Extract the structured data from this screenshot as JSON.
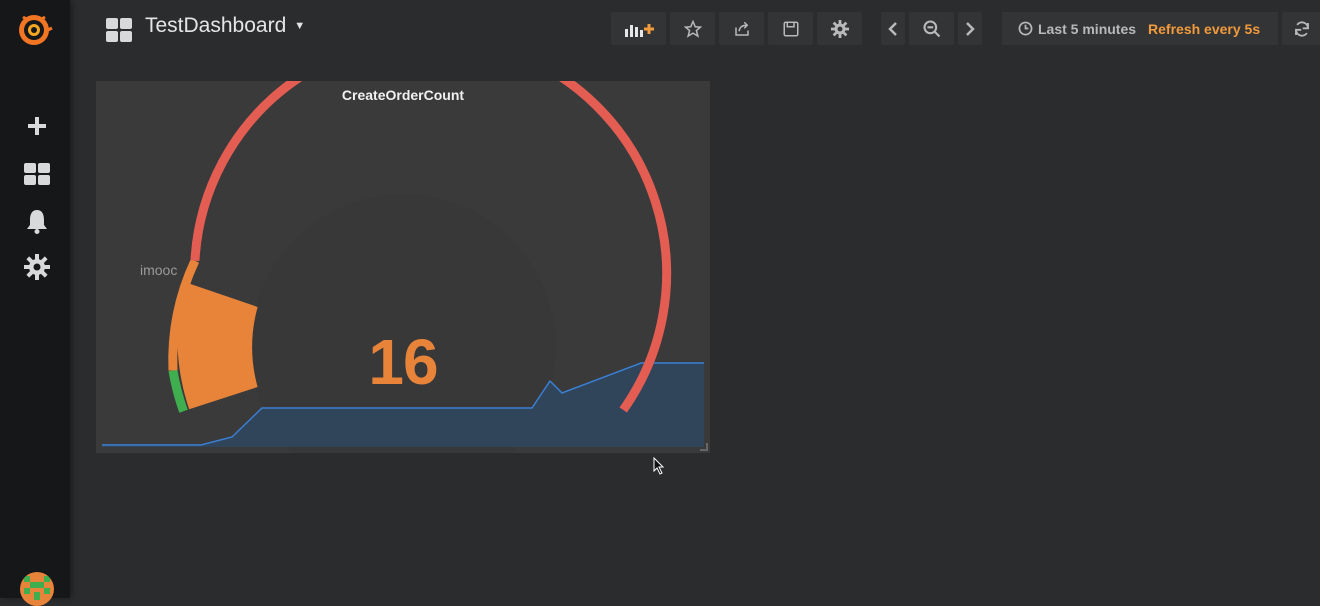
{
  "app": {
    "name": "Grafana",
    "accent_color": "#f29a3c"
  },
  "sidebar": {
    "items": [
      {
        "icon": "plus-icon"
      },
      {
        "icon": "dashboards-icon"
      },
      {
        "icon": "bell-icon"
      },
      {
        "icon": "gear-icon"
      }
    ]
  },
  "header": {
    "dashboard_title": "TestDashboard",
    "toolbar_icons": [
      "add-panel-icon",
      "star-icon",
      "share-icon",
      "save-icon",
      "gear-icon"
    ],
    "time_range": "Last 5 minutes",
    "refresh": "Refresh every 5s"
  },
  "panel": {
    "title": "CreateOrderCount",
    "type": "singlestat",
    "value": "16",
    "series_label": "imooc",
    "gauge": {
      "value_color": "#e8843a",
      "threshold_colors": [
        "#3fae4f",
        "#e8843a",
        "#e45d52"
      ],
      "sparkline_color": "#3a7fd4",
      "sparkline_fill": "#31455a"
    }
  }
}
